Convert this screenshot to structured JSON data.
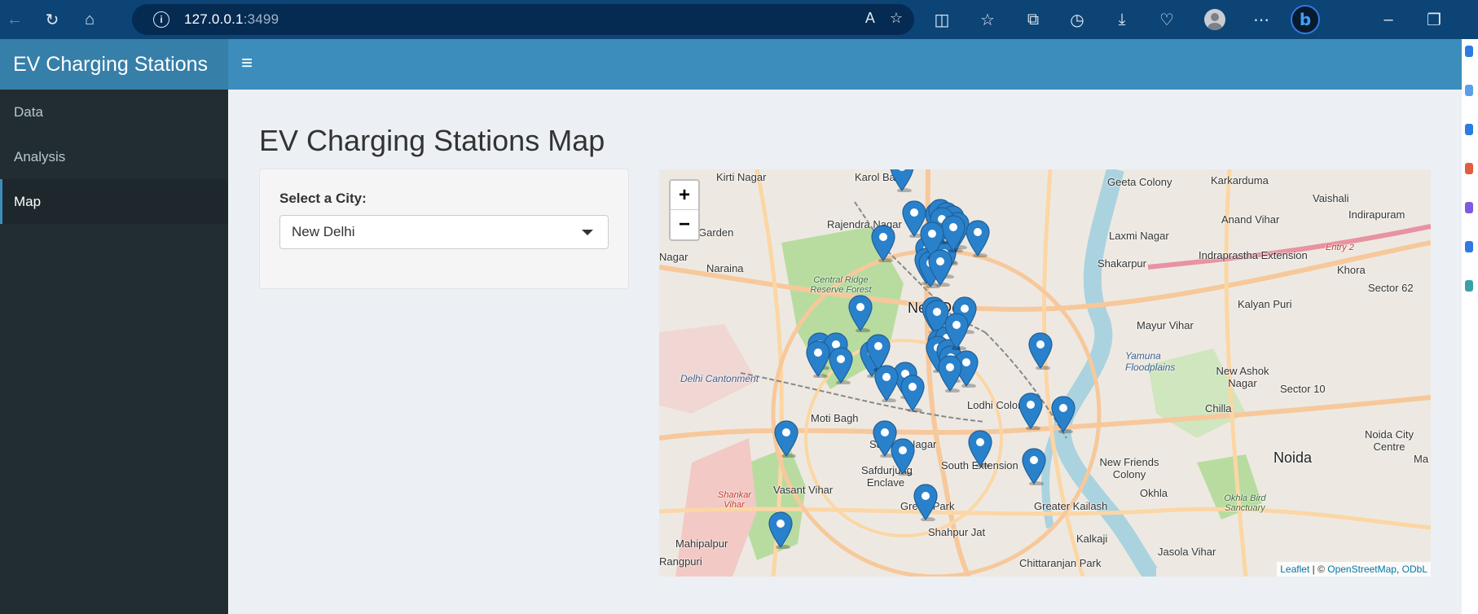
{
  "browser": {
    "url_host": "127.0.0.1",
    "url_port": ":3499"
  },
  "app": {
    "title": "EV Charging Stations",
    "sidebar": {
      "items": [
        {
          "label": "Data",
          "active": false
        },
        {
          "label": "Analysis",
          "active": false
        },
        {
          "label": "Map",
          "active": true
        }
      ]
    },
    "page_title": "EV Charging Stations Map",
    "city_filter": {
      "label": "Select a City:",
      "selected": "New Delhi"
    }
  },
  "map": {
    "zoom_in": "+",
    "zoom_out": "−",
    "place_labels": [
      "Kirti Nagar",
      "Karol Bagh",
      "Geeta Colony",
      "Karkarduma",
      "Vaishali",
      "Rajendra Nagar",
      "Laxmi Nagar",
      "Anand Vihar",
      "Indirapuram",
      "Shakarpur",
      "Indraprastha Extension",
      "Naraina",
      "Entry 2",
      "Khora",
      "Central Ridge Reserve Forest",
      "Kalyan Puri",
      "Sector 62",
      "New Delhi",
      "Mayur Vihar",
      "Yamuna Floodplains",
      "Delhi Cantonment",
      "New Ashok Nagar",
      "Sector 10",
      "Chilla",
      "Moti Bagh",
      "Lodhi Colony",
      "Sarojini Nagar",
      "Noida City Centre",
      "New Friends Colony",
      "Noida",
      "South Extension",
      "Safdurjung Enclave",
      "Vasant Vihar",
      "Okhla",
      "Shankar Vihar",
      "Greater Kailash",
      "Green Park",
      "Okhla Bird Sanctuary",
      "Mahipalpur",
      "Shahpur Jat",
      "Kalkaji",
      "Jasola Vihar",
      "Rangpuri",
      "Chittaranjan Park",
      "Garden",
      "Nagar",
      "Ma"
    ],
    "station_count": 52,
    "attribution": {
      "leaflet": "Leaflet",
      "separator": " | © ",
      "osm": "OpenStreetMap",
      "comma": ", ",
      "odbl": "ODbL"
    }
  }
}
